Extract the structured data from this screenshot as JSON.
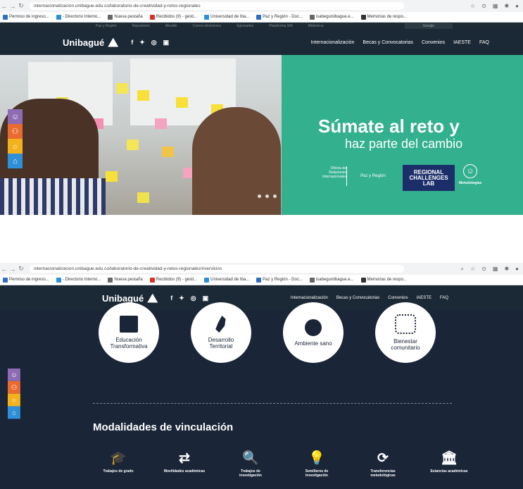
{
  "browser": {
    "url_1": "internacionalizacion.unibague.edu.co/laboratorio-de-creatividad-y-retos-regionales",
    "url_2": "internacionalizacion.unibague.edu.co/laboratorio-de-creatividad-y-retos-regionales/#servicios",
    "bookmarks": [
      {
        "label": "Permiso de ingreso...",
        "color": "#2f6fbd"
      },
      {
        "label": "- Directorio Interno...",
        "color": "#2d8fd5"
      },
      {
        "label": "Nueva pestaña",
        "color": "#666666"
      },
      {
        "label": "Recibidos (9) - gesti...",
        "color": "#d93025"
      },
      {
        "label": "Universidad de Iba...",
        "color": "#2d8fd5"
      },
      {
        "label": "Paz y Región - Doc...",
        "color": "#2f6fbd"
      },
      {
        "label": "isabeguniibague.e...",
        "color": "#666666"
      },
      {
        "label": "Memorias de respo...",
        "color": "#333333"
      }
    ]
  },
  "util_links": [
    "Paz y Región",
    "Repositorio",
    "Moodle",
    "Correo electrónico",
    "Egresados",
    "Plataforma SIA",
    "Biblioteca"
  ],
  "util_search": "Google",
  "brand": "Unibagué",
  "social_icons": [
    "facebook-icon",
    "twitter-icon",
    "instagram-icon",
    "youtube-icon"
  ],
  "menu": [
    "Internacionalización",
    "Becas y Convocatorias",
    "Convenios",
    "IAESTE",
    "FAQ"
  ],
  "hero": {
    "title": "Súmate al reto y",
    "subtitle": "haz parte del cambio",
    "ofi_text": "Oficina de Relaciones Internacionales",
    "pyr_text": "Paz y Región",
    "rcl_lines": [
      "REGIONAL",
      "CHALLENGES",
      "LAB"
    ],
    "metod_label": "Metodologías"
  },
  "side_tabs": [
    {
      "icon": "head-icon",
      "color": "#8f6bb3"
    },
    {
      "icon": "hands-icon",
      "color": "#e96b2f"
    },
    {
      "icon": "bulb-icon",
      "color": "#f3b21d"
    },
    {
      "icon": "graduate-icon",
      "color": "#2f8fd8"
    }
  ],
  "services": [
    {
      "label": "Educación Transformativa",
      "icon": "book-icon"
    },
    {
      "label": "Desarrollo Territorial",
      "icon": "map-icon"
    },
    {
      "label": "Ambiente sano",
      "icon": "globe-hands-icon"
    },
    {
      "label": "Bienestar comunitario",
      "icon": "community-icon"
    }
  ],
  "modalidades_title": "Modalidades de vinculación",
  "modalidades": [
    {
      "label": "Trabajos de grado",
      "icon": "mortarboard-icon",
      "glyph": "🎓"
    },
    {
      "label": "Movilidades académicas",
      "icon": "exchange-icon",
      "glyph": "⇄"
    },
    {
      "label": "Trabajos de investigación",
      "icon": "magnifier-book-icon",
      "glyph": "🔍"
    },
    {
      "label": "Semilleros de investigación",
      "icon": "bulb-icon",
      "glyph": "💡"
    },
    {
      "label": "Transferencias metodológicas",
      "icon": "cycle-icon",
      "glyph": "⟳"
    },
    {
      "label": "Estancias académicas",
      "icon": "institution-icon",
      "glyph": "🏛"
    }
  ]
}
